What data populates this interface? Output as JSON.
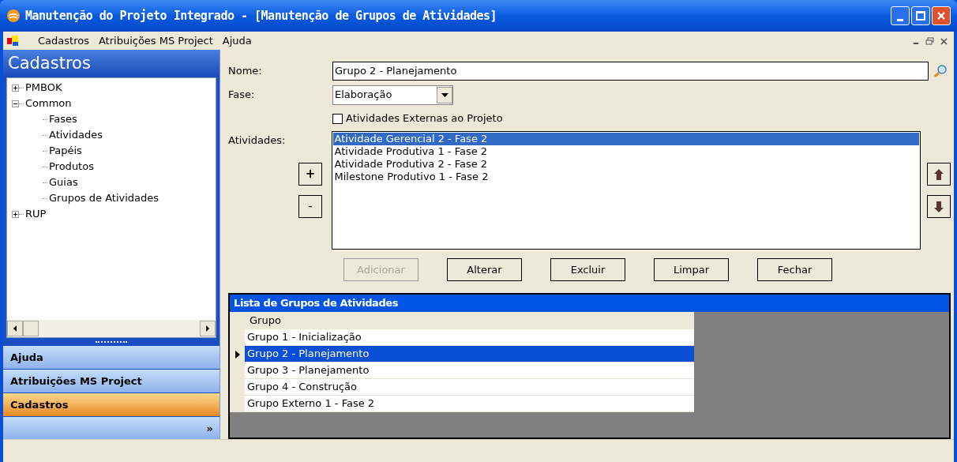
{
  "window": {
    "title": "Manutenção do Projeto Integrado - [Manutenção de Grupos de Atividades]"
  },
  "menu": [
    "Cadastros",
    "Atribuições MS Project",
    "Ajuda"
  ],
  "sidebar": {
    "title": "Cadastros",
    "tree": [
      {
        "label": "PMBOK",
        "expanded": false
      },
      {
        "label": "Common",
        "expanded": true,
        "children": [
          {
            "label": "Fases"
          },
          {
            "label": "Atividades"
          },
          {
            "label": "Papéis"
          },
          {
            "label": "Produtos"
          },
          {
            "label": "Guias"
          },
          {
            "label": "Grupos de Atividades"
          }
        ]
      },
      {
        "label": "RUP",
        "expanded": false
      }
    ],
    "nav": [
      {
        "label": "Ajuda",
        "selected": false
      },
      {
        "label": "Atribuições MS Project",
        "selected": false
      },
      {
        "label": "Cadastros",
        "selected": true
      }
    ],
    "more": "»"
  },
  "form": {
    "name_label": "Nome:",
    "name_value": "Grupo 2 - Planejamento",
    "phase_label": "Fase:",
    "phase_value": "Elaboração",
    "external": {
      "label": "Atividades Externas ao Projeto",
      "checked": false
    },
    "activities_label": "Atividades:",
    "activities": [
      {
        "label": "Atividade Gerencial 2 - Fase 2",
        "selected": true
      },
      {
        "label": "Atividade Produtiva 1 - Fase 2",
        "selected": false
      },
      {
        "label": "Atividade Produtiva 2 - Fase 2",
        "selected": false
      },
      {
        "label": "Milestone Produtivo 1 - Fase 2",
        "selected": false
      }
    ],
    "add_item": "+",
    "remove_item": "-",
    "buttons": [
      {
        "label": "Adicionar",
        "disabled": true
      },
      {
        "label": "Alterar",
        "disabled": false
      },
      {
        "label": "Excluir",
        "disabled": false
      },
      {
        "label": "Limpar",
        "disabled": false
      },
      {
        "label": "Fechar",
        "disabled": false
      }
    ]
  },
  "grid": {
    "title": "Lista de Grupos de Atividades",
    "column": "Grupo",
    "rows": [
      {
        "label": "Grupo 1 - Inicialização",
        "selected": false
      },
      {
        "label": "Grupo 2 - Planejamento",
        "selected": true
      },
      {
        "label": "Grupo 3 - Planejamento",
        "selected": false
      },
      {
        "label": "Grupo 4 - Construção",
        "selected": false
      },
      {
        "label": "Grupo Externo 1 - Fase 2",
        "selected": false
      }
    ]
  }
}
